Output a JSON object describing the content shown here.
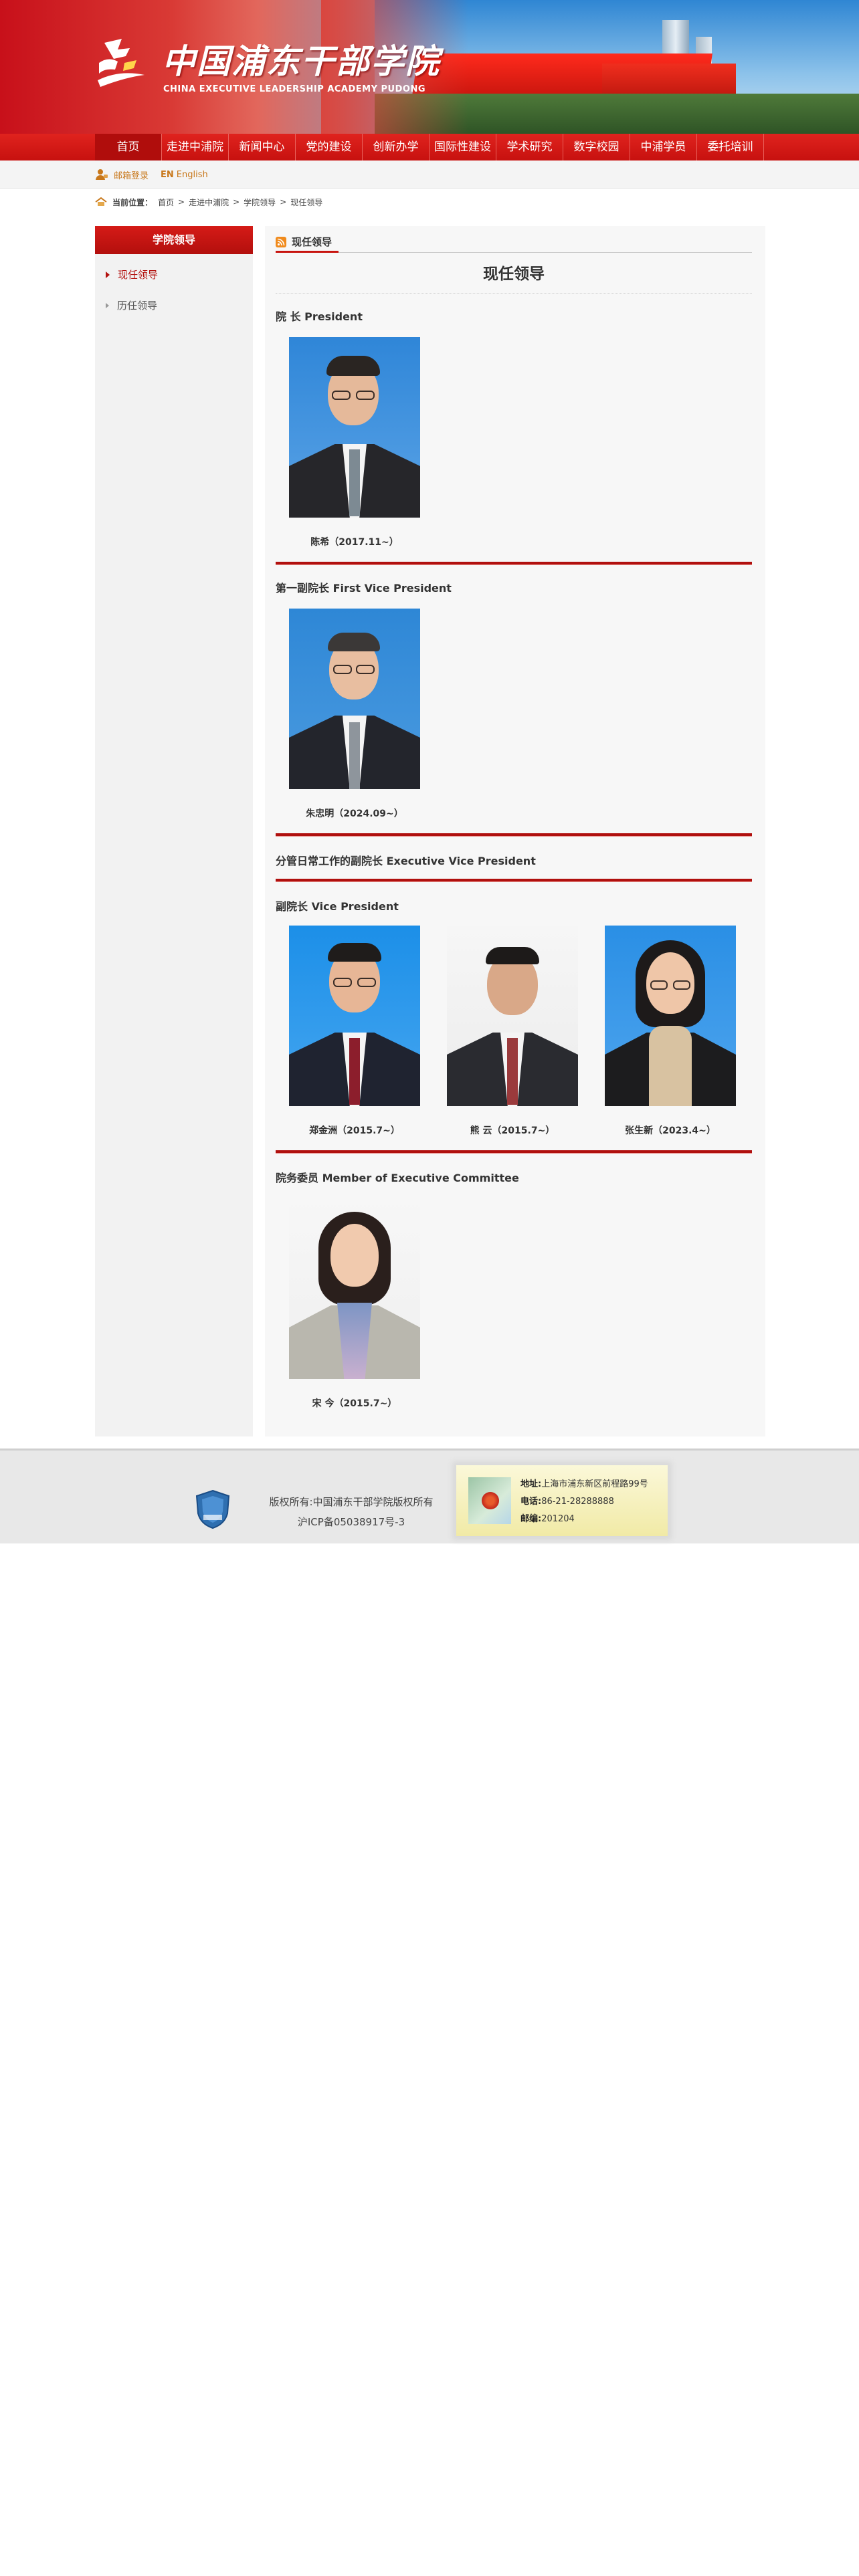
{
  "header": {
    "logo_cn": "中国浦东干部学院",
    "logo_en": "CHINA EXECUTIVE LEADERSHIP ACADEMY PUDONG"
  },
  "nav": {
    "items": [
      "首页",
      "走进中浦院",
      "新闻中心",
      "党的建设",
      "创新办学",
      "国际性建设",
      "学术研究",
      "数字校园",
      "中浦学员",
      "委托培训"
    ],
    "active_index": 0
  },
  "util": {
    "mail_login": "邮箱登录",
    "en_badge": "EN",
    "en_link": "English"
  },
  "breadcrumb": {
    "label": "当前位置：",
    "items": [
      "首页",
      "走进中浦院",
      "学院领导",
      "现任领导"
    ],
    "sep": ">"
  },
  "sidebar": {
    "title": "学院领导",
    "items": [
      {
        "label": "现任领导",
        "active": true
      },
      {
        "label": "历任领导",
        "active": false
      }
    ]
  },
  "main": {
    "tab_label": "现任领导",
    "page_title": "现任领导",
    "sections": [
      {
        "heading": "院 长 President",
        "people": [
          {
            "name": "陈希（2017.11~）"
          }
        ]
      },
      {
        "heading": "第一副院长 First Vice President",
        "people": [
          {
            "name": "朱忠明（2024.09~）"
          }
        ]
      },
      {
        "heading": "分管日常工作的副院长 Executive Vice President",
        "people": []
      },
      {
        "heading": "副院长 Vice President",
        "people": [
          {
            "name": "郑金洲（2015.7~）"
          },
          {
            "name": "熊 云（2015.7~）"
          },
          {
            "name": "张生新（2023.4~）"
          }
        ]
      },
      {
        "heading": "院务委员 Member of Executive Committee",
        "people": [
          {
            "name": "宋 今（2015.7~）"
          }
        ]
      }
    ]
  },
  "footer": {
    "copyright": "版权所有:中国浦东干部学院版权所有",
    "icp": "沪ICP备05038917号-3",
    "address_label": "地址:",
    "address": "上海市浦东新区前程路99号",
    "phone_label": "电话:",
    "phone": "86-21-28288888",
    "zip_label": "邮编:",
    "zip": "201204"
  },
  "colors": {
    "brand_red": "#c8140f",
    "nav_red": "#d81b17",
    "accent_orange": "#c8771a"
  }
}
